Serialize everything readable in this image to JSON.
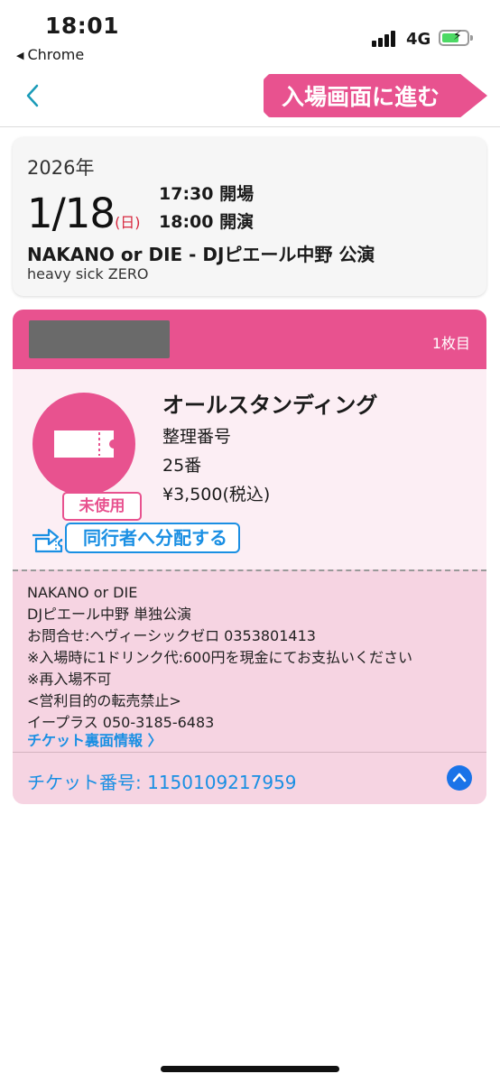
{
  "status_bar": {
    "time": "18:01",
    "back_app": "Chrome",
    "network": "4G"
  },
  "nav": {
    "enter_button": "入場画面に進む"
  },
  "event": {
    "year": "2026年",
    "date": "1/18",
    "weekday": "(日)",
    "doors": "17:30 開場",
    "start": "18:00 開演",
    "title": "NAKANO or DIE - DJピエール中野 公演",
    "subtitle": "heavy sick ZERO"
  },
  "ticket": {
    "count": "1枚目",
    "status": "未使用",
    "seat_type": "オールスタンディング",
    "number_label": "整理番号",
    "number": "25番",
    "price": "¥3,500(税込)",
    "share_label": "同行者へ分配する",
    "info_lines": [
      "NAKANO or DIE",
      "DJピエール中野 単独公演",
      "お問合せ:ヘヴィーシックゼロ 0353801413",
      "※入場時に1ドリンク代:600円を現金にてお支払いください",
      "※再入場不可",
      "<営利目的の転売禁止>",
      "イープラス 050-3185-6483"
    ],
    "back_info_label": "チケット裏面情報 〉",
    "ticket_number": "チケット番号: 1150109217959"
  },
  "colors": {
    "accent_pink": "#e8528f",
    "link_blue": "#1a8fe3",
    "weekday_red": "#d7263d"
  },
  "icons": {
    "nav_back": "chevron-left-icon",
    "ticket": "ticket-icon",
    "share": "share-ticket-icon",
    "collapse": "chevron-up-icon"
  }
}
